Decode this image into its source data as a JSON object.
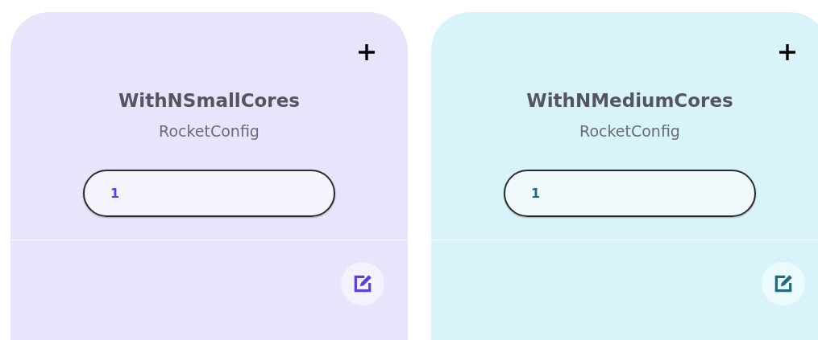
{
  "cards": [
    {
      "title": "WithNSmallCores",
      "subtitle": "RocketConfig",
      "color": "#e7e4fb",
      "field": {
        "value": "1",
        "color": "#5b3fe6"
      }
    },
    {
      "title": "WithNMediumCores",
      "subtitle": "RocketConfig",
      "color": "#d9f3fb",
      "field": {
        "value": "1",
        "color": "#1f6b86"
      }
    }
  ]
}
